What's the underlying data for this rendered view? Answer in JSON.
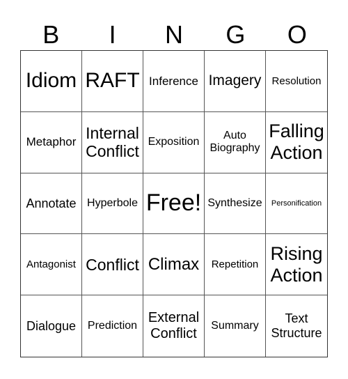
{
  "header": {
    "letters": [
      "B",
      "I",
      "N",
      "G",
      "O"
    ]
  },
  "board": {
    "rows": [
      [
        "Idiom",
        "RAFT",
        "Inference",
        "Imagery",
        "Resolution"
      ],
      [
        "Metaphor",
        "Internal\nConflict",
        "Exposition",
        "Auto\nBiography",
        "Falling\nAction"
      ],
      [
        "Annotate",
        "Hyperbole",
        "Free!",
        "Synthesize",
        "Personification"
      ],
      [
        "Antagonist",
        "Conflict",
        "Climax",
        "Repetition",
        "Rising\nAction"
      ],
      [
        "Dialogue",
        "Prediction",
        "External\nConflict",
        "Summary",
        "Text\nStructure"
      ]
    ],
    "free_space": "Free!"
  }
}
